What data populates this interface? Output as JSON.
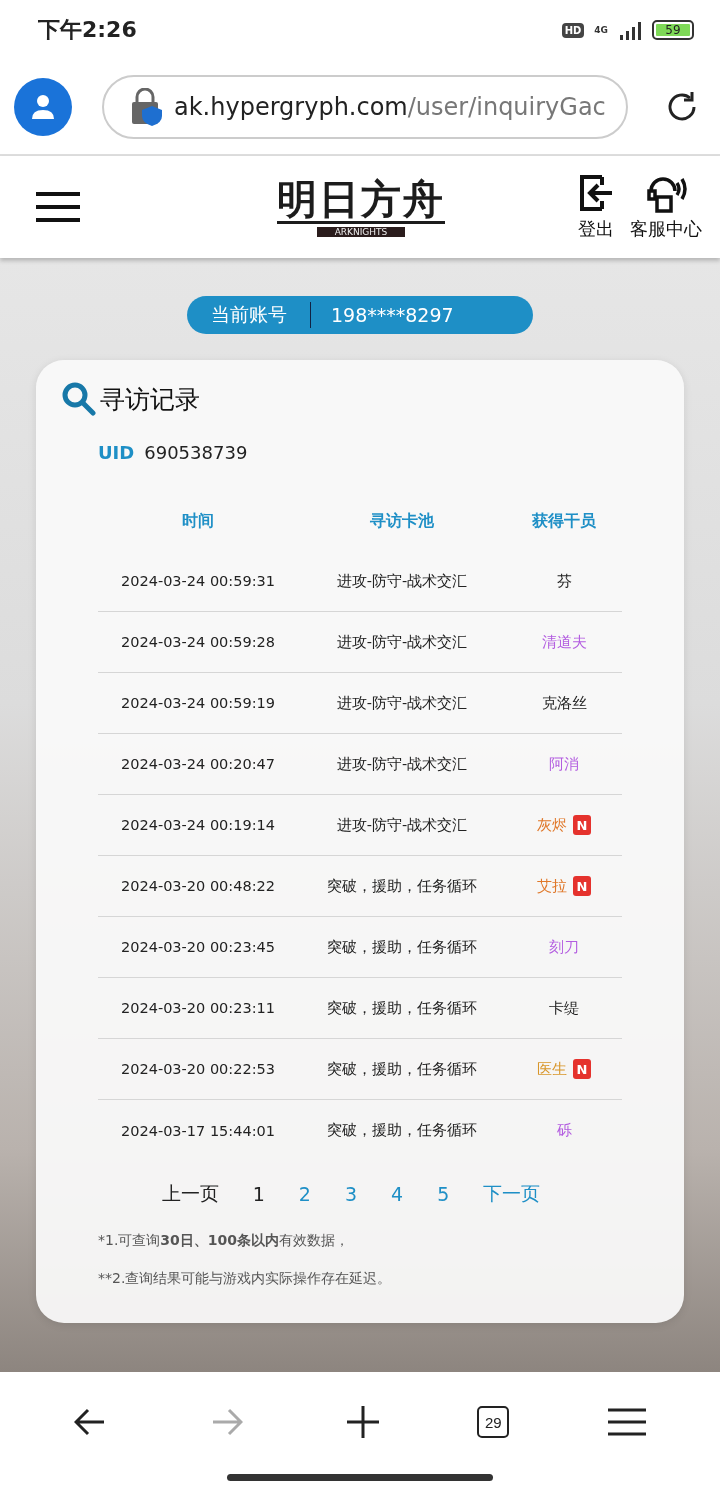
{
  "status_bar": {
    "time": "下午2:26",
    "hd": "HD",
    "network": "4G",
    "battery": "59"
  },
  "address_bar": {
    "host": "ak.hypergryph.com",
    "path": "/user/inquiryGac"
  },
  "site_header": {
    "logo": "明日方舟",
    "logo_sub": "ARKNIGHTS",
    "actions": [
      {
        "label": "登出",
        "kind": "logout"
      },
      {
        "label": "客服中心",
        "kind": "support"
      }
    ]
  },
  "account": {
    "label": "当前账号",
    "value": "198****8297"
  },
  "card": {
    "title": "寻访记录",
    "uid_label": "UID",
    "uid": "690538739",
    "table": {
      "columns": [
        "时间",
        "寻访卡池",
        "获得干员"
      ],
      "rows": [
        {
          "time": "2024-03-24 00:59:31",
          "pool": "进攻-防守-战术交汇",
          "operator": "芬",
          "color": "#222222"
        },
        {
          "time": "2024-03-24 00:59:28",
          "pool": "进攻-防守-战术交汇",
          "operator": "清道夫",
          "color": "#b35de0"
        },
        {
          "time": "2024-03-24 00:59:19",
          "pool": "进攻-防守-战术交汇",
          "operator": "克洛丝",
          "color": "#222222"
        },
        {
          "time": "2024-03-24 00:20:47",
          "pool": "进攻-防守-战术交汇",
          "operator": "阿消",
          "color": "#b35de0"
        },
        {
          "time": "2024-03-24 00:19:14",
          "pool": "进攻-防守-战术交汇",
          "operator": "灰烬",
          "color": "#e0782a",
          "badge": "N"
        },
        {
          "time": "2024-03-20 00:48:22",
          "pool": "突破，援助，任务循环",
          "operator": "艾拉",
          "color": "#e0782a",
          "badge": "N"
        },
        {
          "time": "2024-03-20 00:23:45",
          "pool": "突破，援助，任务循环",
          "operator": "刻刀",
          "color": "#b35de0"
        },
        {
          "time": "2024-03-20 00:23:11",
          "pool": "突破，援助，任务循环",
          "operator": "卡缇",
          "color": "#222222"
        },
        {
          "time": "2024-03-20 00:22:53",
          "pool": "突破，援助，任务循环",
          "operator": "医生",
          "color": "#d8962a",
          "badge": "N"
        },
        {
          "time": "2024-03-17 15:44:01",
          "pool": "突破，援助，任务循环",
          "operator": "砾",
          "color": "#b35de0"
        }
      ]
    },
    "pagination": {
      "prev": {
        "label": "上一页",
        "disabled": true
      },
      "pages": [
        {
          "label": "1",
          "selected": true
        },
        {
          "label": "2",
          "selected": false
        },
        {
          "label": "3",
          "selected": false
        },
        {
          "label": "4",
          "selected": false
        },
        {
          "label": "5",
          "selected": false
        }
      ],
      "next": {
        "label": "下一页",
        "disabled": false
      }
    },
    "notes": [
      {
        "kind": "marked",
        "text": "*1.可查询**30日、100条以内**有效数据，"
      },
      {
        "kind": "plain",
        "text": "**2.查询结果可能与游戏内实际操作存在延迟。"
      }
    ]
  },
  "bottom_bar": {
    "tabs_count": "29",
    "forward_disabled": true
  }
}
